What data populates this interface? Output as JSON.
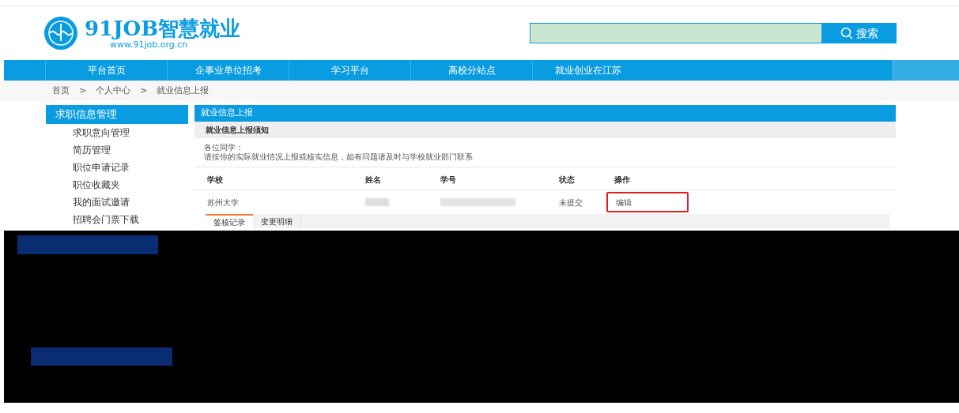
{
  "logo": {
    "title": "91JOB智慧就业",
    "url": "www.91job.org.cn"
  },
  "search": {
    "button": "搜索"
  },
  "nav": [
    {
      "label": "平台首页",
      "selected": false
    },
    {
      "label": "企事业单位招考",
      "selected": false
    },
    {
      "label": "学习平台",
      "selected": false
    },
    {
      "label": "高校分站点",
      "selected": false
    },
    {
      "label": "就业创业在江苏",
      "selected": false
    }
  ],
  "breadcrumb": [
    "首页",
    ">",
    "个人中心",
    ">",
    "就业信息上报"
  ],
  "sidebar": {
    "title": "求职信息管理",
    "items": [
      "求职意向管理",
      "简历管理",
      "职位申请记录",
      "职位收藏夹",
      "我的面试邀请",
      "招聘会门票下载"
    ]
  },
  "panel": {
    "title": "就业信息上报",
    "notice_title": "就业信息上报须知",
    "notice_lines": [
      "各位同学：",
      "请按你的实际就业情况上报或核实信息，如有问题请及时与学校就业部门联系"
    ],
    "table": {
      "columns": [
        "学校",
        "姓名",
        "学号",
        "状态",
        "操作"
      ],
      "rows": [
        {
          "school": "苏州大学",
          "status": "未提交",
          "action": "编辑",
          "highlighted": true
        }
      ]
    },
    "tabs": [
      {
        "label": "签核记录",
        "selected": true
      },
      {
        "label": "变更明细",
        "selected": false
      }
    ]
  }
}
